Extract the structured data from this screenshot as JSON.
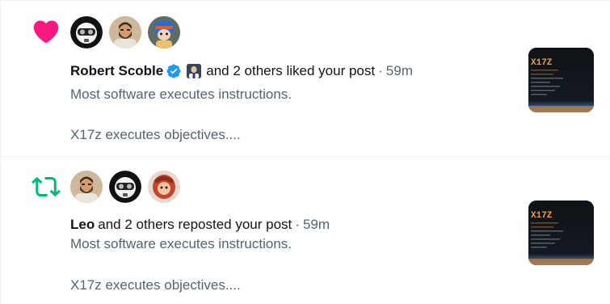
{
  "notifications": [
    {
      "type_icon": "heart-icon",
      "avatars": [
        "robot-helmet-avatar",
        "bearded-man-avatar",
        "blue-helmet-character-avatar"
      ],
      "actor_name": "Robert Scoble",
      "verified": true,
      "action_text": "and 2 others liked your post",
      "separator": "·",
      "time": "59m",
      "post_line1": "Most software executes instructions.",
      "post_line2": "X17z executes objectives....",
      "thumb_label": "X17Z"
    },
    {
      "type_icon": "repost-icon",
      "avatars": [
        "bearded-man-avatar",
        "robot-helmet-avatar",
        "red-character-avatar"
      ],
      "actor_name": "Leo",
      "verified": false,
      "action_text": "and 2 others reposted your post",
      "separator": "·",
      "time": "59m",
      "post_line1": "Most software executes instructions.",
      "post_line2": "X17z executes objectives....",
      "thumb_label": "X17Z"
    }
  ],
  "colors": {
    "like": "#f91880",
    "repost": "#00ba7c",
    "verified": "#1d9bf0",
    "secondary_text": "#536471",
    "primary_text": "#0f1419"
  }
}
